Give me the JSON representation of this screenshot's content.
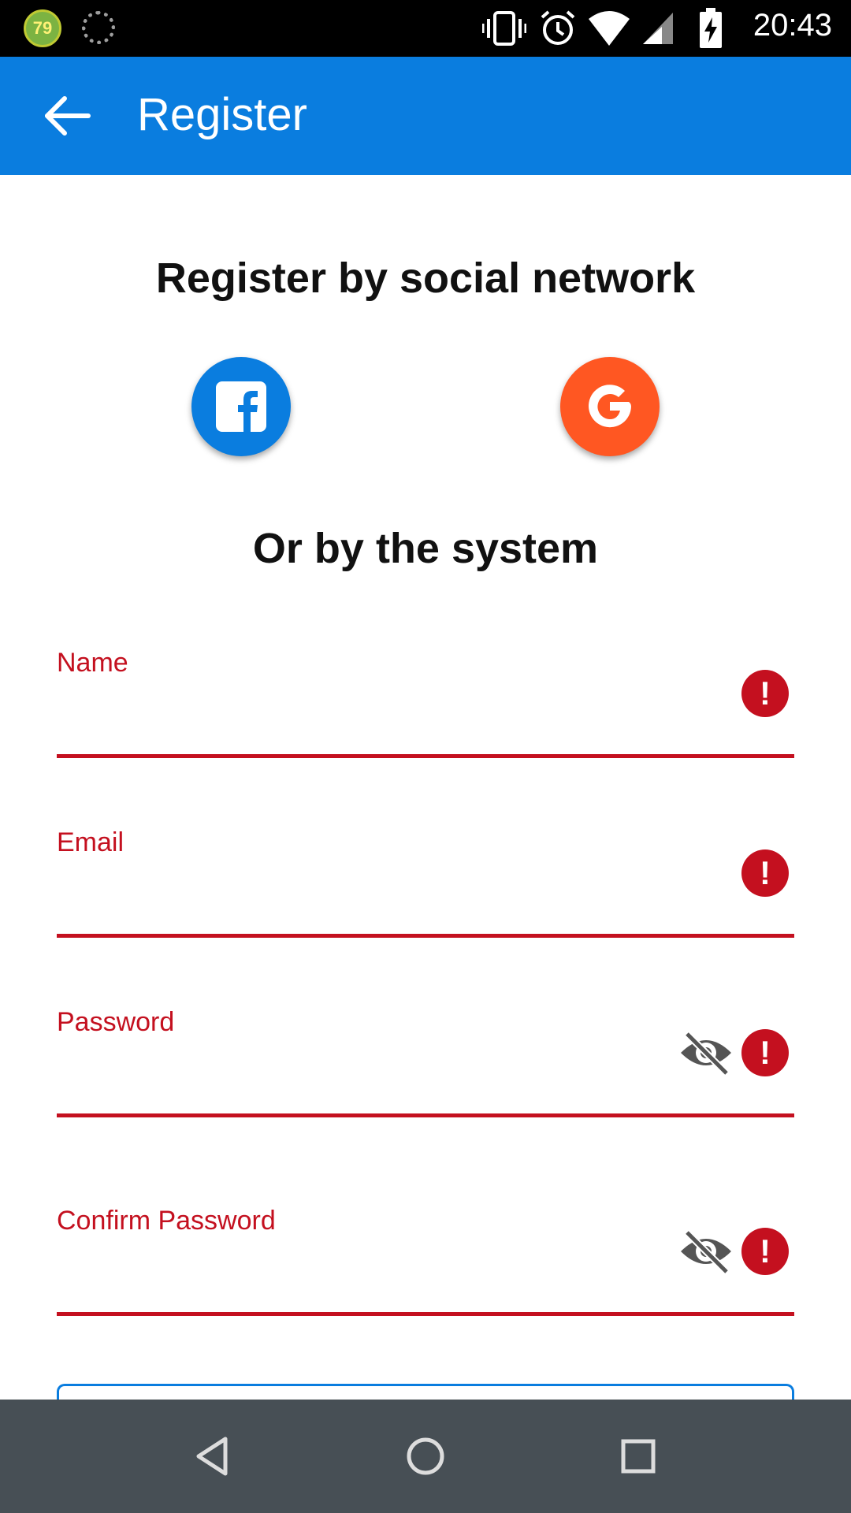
{
  "status_bar": {
    "badge_text": "79",
    "time": "20:43",
    "icons": [
      "battery-saver-badge",
      "loading-spinner-icon",
      "vibrate-icon",
      "alarm-icon",
      "wifi-icon",
      "signal-icon",
      "battery-charging-icon"
    ]
  },
  "app_bar": {
    "title": "Register",
    "back_icon": "arrow-back-icon",
    "color": "#0a7ddf"
  },
  "social": {
    "heading": "Register by social network",
    "buttons": [
      {
        "name": "facebook",
        "icon": "facebook-icon",
        "color": "#0a7ddf"
      },
      {
        "name": "google",
        "icon": "google-icon",
        "color": "#ff5722"
      }
    ]
  },
  "system_heading": "Or by the system",
  "form": {
    "error_color": "#c4101f",
    "fields": [
      {
        "label": "Name",
        "value": ""
      },
      {
        "label": "Email",
        "value": ""
      },
      {
        "label": "Password",
        "value": "",
        "toggle_icon": "eye-off-icon"
      },
      {
        "label": "Confirm Password",
        "value": "",
        "toggle_icon": "eye-off-icon"
      }
    ],
    "error_icon": "error-alert-icon"
  },
  "nav_bar": {
    "buttons": [
      "back-triangle-icon",
      "home-circle-icon",
      "recents-square-icon"
    ]
  }
}
